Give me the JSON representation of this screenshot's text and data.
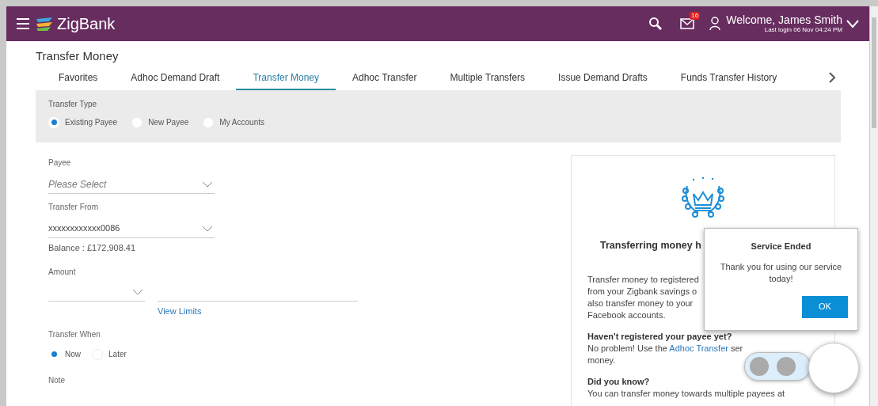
{
  "header": {
    "brand": "ZigBank",
    "notification_count": "16",
    "welcome": "Welcome, James Smith",
    "last_login": "Last login 06 Nov 04:24 PM"
  },
  "page_title": "Transfer Money",
  "tabs": [
    {
      "label": "Favorites",
      "selected": false
    },
    {
      "label": "Adhoc Demand Draft",
      "selected": false
    },
    {
      "label": "Transfer Money",
      "selected": true
    },
    {
      "label": "Adhoc Transfer",
      "selected": false
    },
    {
      "label": "Multiple Transfers",
      "selected": false
    },
    {
      "label": "Issue Demand Drafts",
      "selected": false
    },
    {
      "label": "Funds Transfer History",
      "selected": false
    }
  ],
  "transfer_type": {
    "label": "Transfer Type",
    "options": [
      {
        "label": "Existing Payee",
        "selected": true
      },
      {
        "label": "New Payee",
        "selected": false
      },
      {
        "label": "My Accounts",
        "selected": false
      }
    ]
  },
  "payee": {
    "label": "Payee",
    "placeholder": "Please Select"
  },
  "transfer_from": {
    "label": "Transfer From",
    "value": "xxxxxxxxxxxx0086",
    "balance": "Balance : £172,908.41"
  },
  "amount": {
    "label": "Amount",
    "link": "View Limits"
  },
  "transfer_when": {
    "label": "Transfer When",
    "options": [
      {
        "label": "Now",
        "selected": true
      },
      {
        "label": "Later",
        "selected": false
      }
    ]
  },
  "note": {
    "label": "Note"
  },
  "info_card": {
    "title": "Transferring money h",
    "paragraphs": [
      {
        "lines": [
          [
            {
              "kind": "text",
              "text": "Transfer money to registered"
            }
          ],
          [
            {
              "kind": "text",
              "text": "from your Zigbank savings o"
            }
          ],
          [
            {
              "kind": "text",
              "text": "also transfer money to your"
            }
          ],
          [
            {
              "kind": "text",
              "text": "Facebook accounts."
            }
          ]
        ]
      },
      {
        "heading": "Haven't registered your payee yet?",
        "lines": [
          [
            {
              "kind": "text",
              "text": "No problem! Use the "
            },
            {
              "kind": "link",
              "text": "Adhoc Transfer"
            },
            {
              "kind": "text",
              "text": " ser"
            }
          ],
          [
            {
              "kind": "text",
              "text": "money."
            }
          ]
        ]
      },
      {
        "heading": "Did you know?",
        "lines": [
          [
            {
              "kind": "text",
              "text": "You can transfer money towards multiple payees at"
            }
          ]
        ]
      }
    ]
  },
  "dialog": {
    "title": "Service Ended",
    "message": "Thank you for using our service today!",
    "button": "OK"
  }
}
